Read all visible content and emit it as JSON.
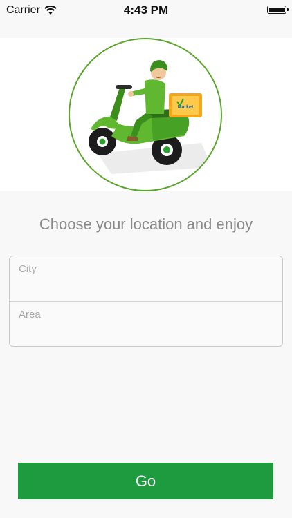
{
  "status_bar": {
    "carrier": "Carrier",
    "time": "4:43 PM",
    "battery_level": 1.0
  },
  "hero": {
    "illustration": "delivery-scooter-illustration",
    "box_text": "Market",
    "accent_color": "#5aa52a"
  },
  "headline": "Choose your location and enjoy",
  "form": {
    "city_placeholder": "City",
    "city_value": "",
    "area_placeholder": "Area",
    "area_value": ""
  },
  "go_button": {
    "label": "Go",
    "color": "#1e9b3f"
  }
}
